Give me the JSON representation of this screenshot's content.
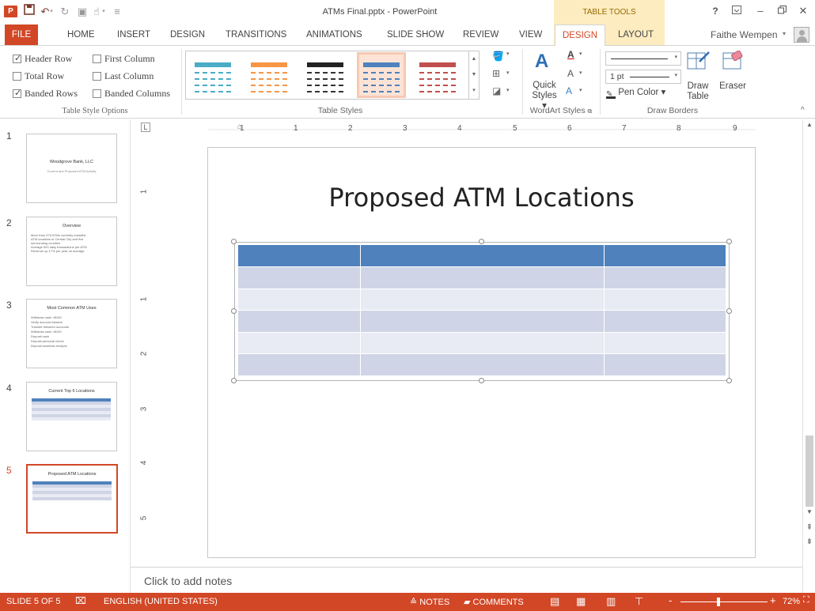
{
  "window": {
    "title": "ATMs Final.pptx - PowerPoint",
    "contextual_group": "TABLE TOOLS",
    "user_name": "Faithe Wempen"
  },
  "icons": {
    "ppt_logo": "P",
    "save": "save-icon",
    "undo": "undo-icon",
    "redo": "redo-icon",
    "start_from_beginning": "presentation-start-icon",
    "touch_mode": "touch-mode-icon",
    "customize_qat": "qat-dropdown-icon",
    "help": "help-icon",
    "ribbon_options": "ribbon-display-icon",
    "minimize": "minimize-icon",
    "restore": "restore-icon",
    "close": "close-icon"
  },
  "tabs": [
    {
      "label": "FILE"
    },
    {
      "label": "HOME"
    },
    {
      "label": "INSERT"
    },
    {
      "label": "DESIGN"
    },
    {
      "label": "TRANSITIONS"
    },
    {
      "label": "ANIMATIONS"
    },
    {
      "label": "SLIDE SHOW"
    },
    {
      "label": "REVIEW"
    },
    {
      "label": "VIEW"
    },
    {
      "label": "DESIGN"
    },
    {
      "label": "LAYOUT"
    }
  ],
  "ribbon": {
    "table_style_options": {
      "label": "Table Style Options",
      "header_row": "Header Row",
      "first_column": "First Column",
      "total_row": "Total Row",
      "last_column": "Last Column",
      "banded_rows": "Banded Rows",
      "banded_columns": "Banded Columns"
    },
    "table_styles": {
      "label": "Table Styles",
      "styles": [
        {
          "color": "#4bacc6"
        },
        {
          "color": "#f79646"
        },
        {
          "color": "#222222"
        },
        {
          "color": "#4f81bd"
        },
        {
          "color": "#c0504d"
        }
      ]
    },
    "wordart": {
      "label": "WordArt Styles",
      "quick_styles": "Quick",
      "quick_styles_2": "Styles"
    },
    "draw_borders": {
      "label": "Draw Borders",
      "pen_weight": "1 pt",
      "pen_color": "Pen Color",
      "draw_table": "Draw",
      "draw_table_2": "Table",
      "eraser": "Eraser"
    }
  },
  "thumbnails": [
    {
      "num": "1",
      "title": "Woodgrove Bank, LLC",
      "subtitle": "Current and Proposed ATM Activity"
    },
    {
      "num": "2",
      "title": "Overview",
      "bullets": [
        "More than 375 ATMs currently installed",
        "ATM locations in Central City and five",
        "surrounding counties",
        "Average 520 daily transactions per ATM",
        "Revenue up 17% per year on average"
      ]
    },
    {
      "num": "3",
      "title": "Most Common ATM Uses",
      "bullets": [
        "Withdraw cash <$100",
        "Verify account balance",
        "Transfer between accounts",
        "Withdraw cash >$100",
        "Deposit cash",
        "Deposit personal check",
        "Deposit business receipts"
      ]
    },
    {
      "num": "4",
      "title": "Current Top 6 Locations"
    },
    {
      "num": "5",
      "title": "Proposed ATM Locations"
    }
  ],
  "rulers": {
    "horizontal": [
      "1",
      "1",
      "2",
      "3",
      "4",
      "5",
      "6",
      "7",
      "8",
      "9"
    ],
    "vertical": [
      "1",
      "1",
      "2",
      "3",
      "4",
      "5"
    ],
    "corner": "L"
  },
  "slide": {
    "title": "Proposed ATM Locations",
    "table": {
      "columns": 3,
      "rows": 6,
      "header_color": "#4f81bd",
      "band_dark": "#cfd5e6",
      "band_light": "#e8ebf4"
    }
  },
  "notes_placeholder": "Click to add notes",
  "status": {
    "slide_info": "SLIDE 5 OF 5",
    "language": "ENGLISH (UNITED STATES)",
    "notes": "NOTES",
    "comments": "COMMENTS",
    "zoom": "72%",
    "zoom_minus": "-",
    "zoom_plus": "+"
  },
  "colors": {
    "accent": "#d24726",
    "contextual": "#fcecc0"
  }
}
